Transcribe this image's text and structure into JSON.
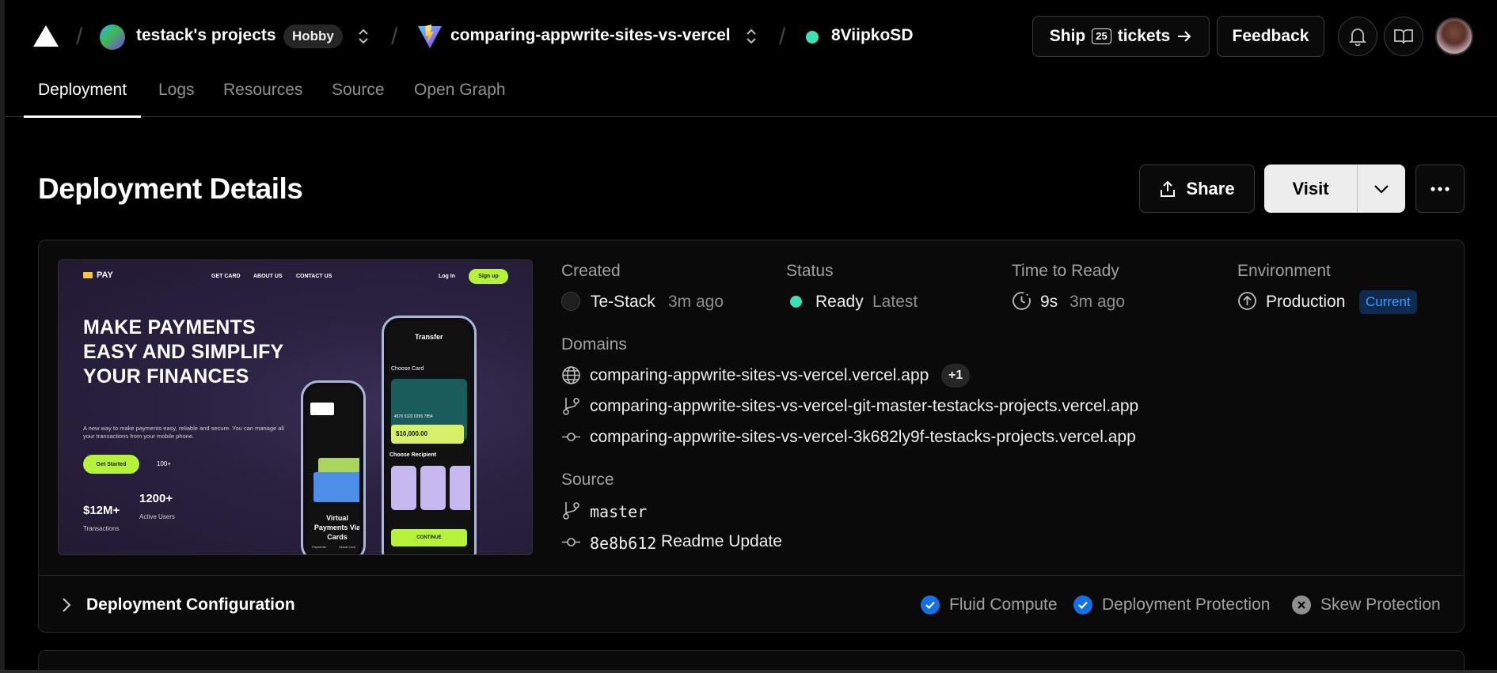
{
  "header": {
    "team_name": "testack's projects",
    "plan_badge": "Hobby",
    "project_name": "comparing-appwrite-sites-vs-vercel",
    "deployment_id": "8ViipkoSD",
    "ship_label_before": "Ship",
    "ship_count": "25",
    "ship_label_after": "tickets",
    "feedback_label": "Feedback"
  },
  "tabs": [
    {
      "label": "Deployment",
      "active": true
    },
    {
      "label": "Logs",
      "active": false
    },
    {
      "label": "Resources",
      "active": false
    },
    {
      "label": "Source",
      "active": false
    },
    {
      "label": "Open Graph",
      "active": false
    }
  ],
  "page": {
    "title": "Deployment Details",
    "share_label": "Share",
    "visit_label": "Visit"
  },
  "preview": {
    "brand": "PAY",
    "nav": [
      "GET CARD",
      "ABOUT US",
      "CONTACT US"
    ],
    "login": "Log In",
    "signup": "Sign up",
    "headline": "MAKE PAYMENTS EASY AND SIMPLIFY YOUR FINANCES",
    "subtext": "A new way to make payments easy, reliable and secure. You can manage all your transactions from your mobile phone.",
    "cta": "Get Started",
    "cta_count": "100+",
    "stat1_value": "$12M+",
    "stat1_label": "Transactions",
    "stat2_value": "1200+",
    "stat2_label": "Active Users",
    "phone_title": "Transfer",
    "phone_choose_card": "Choose Card",
    "phone_card_number": "4576 5322 0255 7854",
    "phone_amount": "$10,000.00",
    "phone_choose_recipient": "Choose Recipient",
    "phone_continue": "CONTINUE",
    "phone2_caption": "Virtual Payments Via Cards",
    "phone2_link1": "Payments",
    "phone2_link2": "Virtual Card"
  },
  "details": {
    "created_label": "Created",
    "created_by": "Te-Stack",
    "created_ago": "3m ago",
    "status_label": "Status",
    "status_value": "Ready",
    "status_tag": "Latest",
    "ttr_label": "Time to Ready",
    "ttr_value": "9s",
    "ttr_ago": "3m ago",
    "env_label": "Environment",
    "env_value": "Production",
    "env_badge": "Current",
    "domains_label": "Domains",
    "domains": [
      "comparing-appwrite-sites-vs-vercel.vercel.app",
      "comparing-appwrite-sites-vs-vercel-git-master-testacks-projects.vercel.app",
      "comparing-appwrite-sites-vs-vercel-3k682ly9f-testacks-projects.vercel.app"
    ],
    "domains_more": "+1",
    "source_label": "Source",
    "branch": "master",
    "commit_hash": "8e8b612",
    "commit_message": "Readme Update"
  },
  "config": {
    "title": "Deployment Configuration",
    "features": [
      {
        "label": "Fluid Compute",
        "enabled": true
      },
      {
        "label": "Deployment Protection",
        "enabled": true
      },
      {
        "label": "Skew Protection",
        "enabled": false
      }
    ]
  },
  "colors": {
    "background": "#000000",
    "accent_blue": "#1670e3",
    "ready_green": "#3fe0b5",
    "lime": "#b6f23a"
  }
}
